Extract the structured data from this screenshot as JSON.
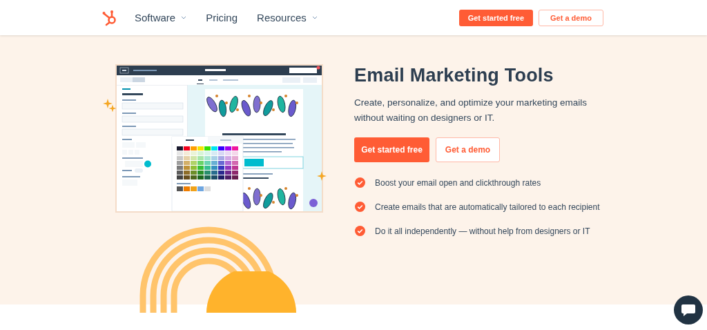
{
  "nav": {
    "items": [
      {
        "label": "Software",
        "dropdown": true
      },
      {
        "label": "Pricing",
        "dropdown": false
      },
      {
        "label": "Resources",
        "dropdown": true
      }
    ],
    "buttons": [
      {
        "label": "Get started free",
        "kind": "primary"
      },
      {
        "label": "Get a demo",
        "kind": "secondary"
      }
    ]
  },
  "hero": {
    "title": "Email Marketing Tools",
    "description": "Create, personalize, and optimize your marketing emails without waiting on designers or IT.",
    "buttons": [
      {
        "label": "Get started free",
        "kind": "primary"
      },
      {
        "label": "Get a demo",
        "kind": "secondary"
      }
    ],
    "features": [
      "Boost your email open and clickthrough rates",
      "Create emails that are automatically tailored to each recipient",
      "Do it all independently — without help from designers or IT"
    ]
  }
}
